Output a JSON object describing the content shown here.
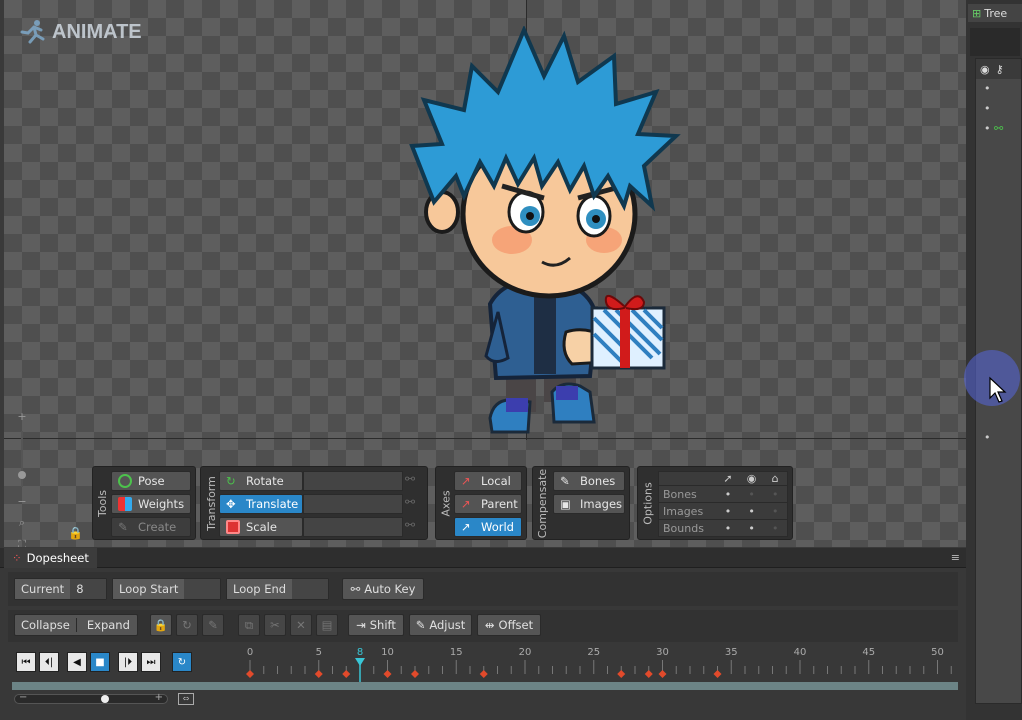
{
  "logo": {
    "text": "ANIMATE"
  },
  "tree": {
    "tab_label": "Tree"
  },
  "tools": {
    "section_label": "Tools",
    "pose": "Pose",
    "weights": "Weights",
    "create": "Create"
  },
  "transform": {
    "section_label": "Transform",
    "rotate": "Rotate",
    "translate": "Translate",
    "scale": "Scale"
  },
  "axes": {
    "section_label": "Axes",
    "local": "Local",
    "parent": "Parent",
    "world": "World"
  },
  "compensate": {
    "section_label": "Compensate",
    "bones": "Bones",
    "images": "Images"
  },
  "options": {
    "section_label": "Options",
    "rows": [
      "Bones",
      "Images",
      "Bounds"
    ]
  },
  "dopesheet": {
    "tab_label": "Dopesheet",
    "current_label": "Current",
    "current_value": "8",
    "loop_start_label": "Loop Start",
    "loop_end_label": "Loop End",
    "auto_key": "Auto Key",
    "collapse": "Collapse",
    "expand": "Expand",
    "shift": "Shift",
    "adjust": "Adjust",
    "offset": "Offset",
    "current_frame": 8,
    "ruler_labels": [
      "0",
      "5",
      "8",
      "10",
      "15",
      "20",
      "25",
      "30",
      "35",
      "40",
      "45",
      "50"
    ],
    "key_frames": [
      0,
      5,
      7,
      10,
      12,
      17,
      27,
      29,
      30,
      34
    ]
  },
  "colors": {
    "accent": "#2a87c8",
    "keyframe": "#e24a2b",
    "playhead": "#39c6d6"
  }
}
